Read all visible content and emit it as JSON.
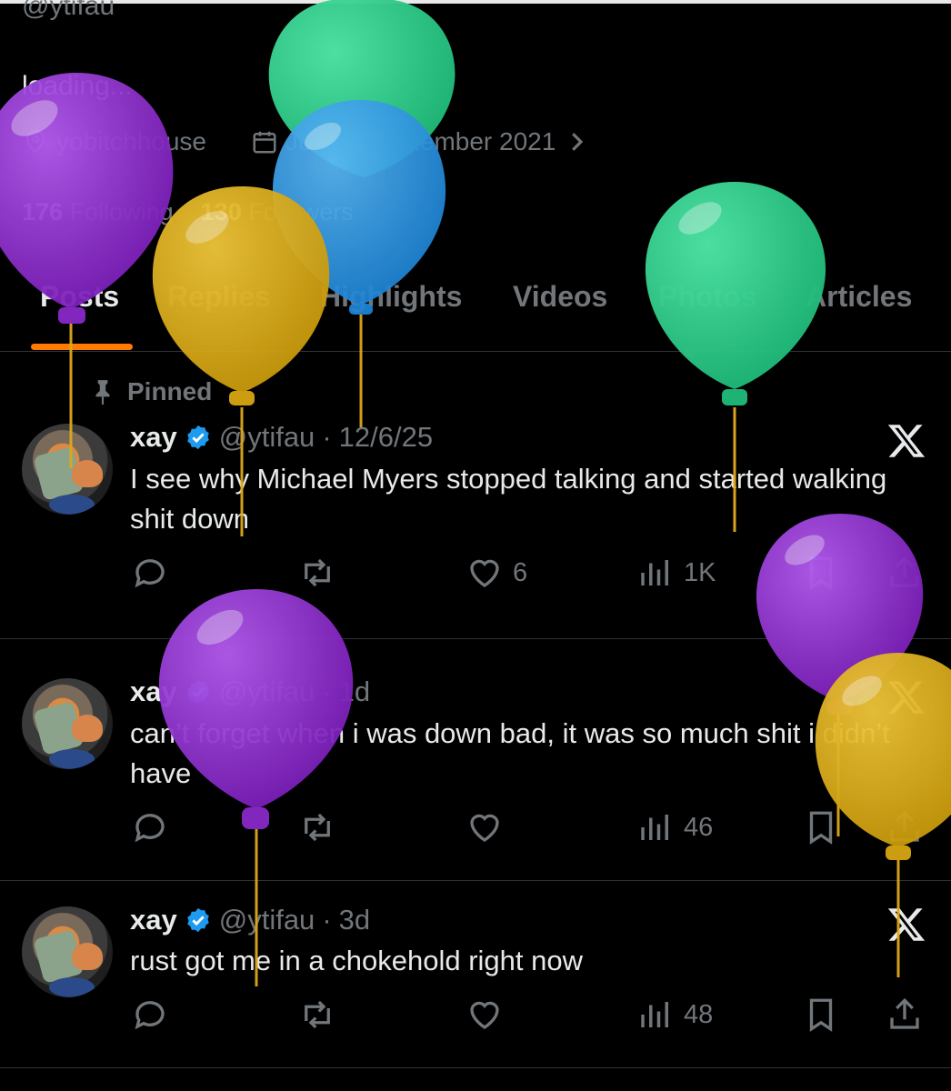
{
  "profile": {
    "handle": "@ytifau",
    "bio": "loading...",
    "location": "yobitchhouse",
    "joined": "Joined September 2021",
    "following_count": "176",
    "following_label": "Following",
    "followers_count": "130",
    "followers_label": "Followers"
  },
  "tabs": [
    "Posts",
    "Replies",
    "Highlights",
    "Videos",
    "Photos",
    "Articles"
  ],
  "pinned_label": "Pinned",
  "posts": [
    {
      "name": "xay",
      "handle": "@ytifau",
      "sep": "·",
      "time": "12/6/25",
      "text": "I see why Michael Myers stopped talking and started walking shit down",
      "likes": "6",
      "views": "1K"
    },
    {
      "name": "xay",
      "handle": "@ytifau",
      "sep": "·",
      "time": "1d",
      "text": "can’t forget when i was down bad, it was so much shit i didn’t have",
      "likes": "",
      "views": "46"
    },
    {
      "name": "xay",
      "handle": "@ytifau",
      "sep": "·",
      "time": "3d",
      "text": "rust got me in a chokehold right now",
      "likes": "",
      "views": "48"
    }
  ],
  "colors": {
    "accent_tab": "#ff7a00",
    "verified": "#1d9bf0",
    "balloon_purple": "#9b30d9",
    "balloon_yellow": "#e2b21a",
    "balloon_green": "#2fd48f",
    "balloon_blue": "#2f9fe8"
  }
}
